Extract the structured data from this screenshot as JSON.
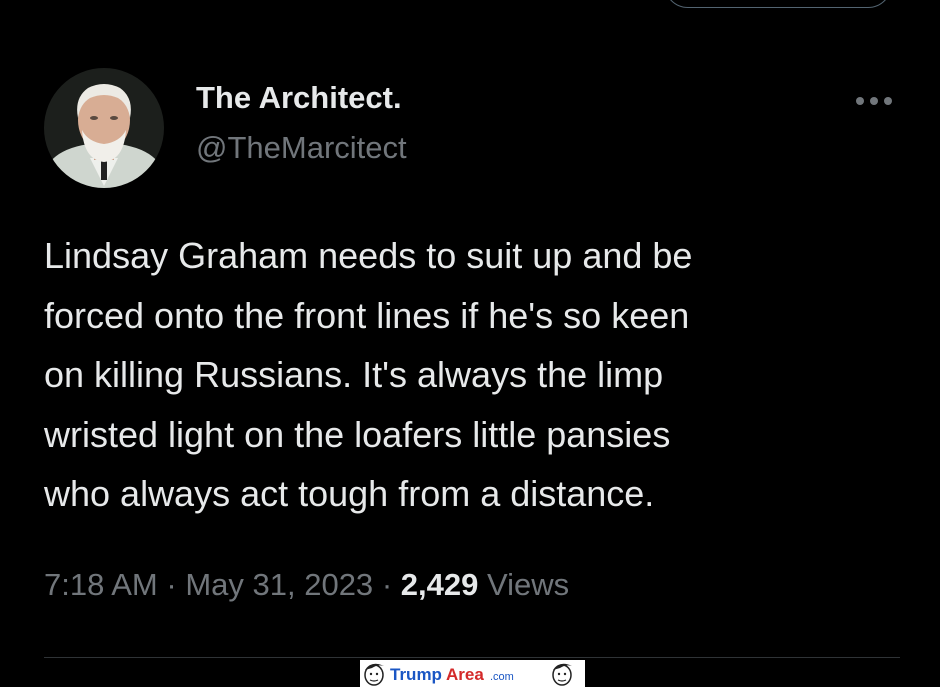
{
  "header": {
    "display_name": "The Architect.",
    "handle": "@TheMarcitect"
  },
  "tweet": {
    "text": "Lindsay Graham needs to suit up and be\nforced onto the front lines if he's so keen\non killing Russians. It's always the limp\nwristed light on the loafers little pansies\nwho always act tough from a distance."
  },
  "meta": {
    "time": "7:18 AM",
    "separator": "·",
    "date": "May 31, 2023",
    "views_count": "2,429",
    "views_label": "Views"
  },
  "watermark": {
    "brand_part1": "Trump",
    "brand_part2": "Area",
    "brand_suffix": ".com"
  },
  "icons": {
    "more": "more-horizontal-icon"
  },
  "colors": {
    "background": "#000000",
    "primary_text": "#e7e9ea",
    "secondary_text": "#71767b",
    "divider": "#2f3336",
    "watermark_blue": "#1a56c4",
    "watermark_red": "#d42a2a"
  }
}
